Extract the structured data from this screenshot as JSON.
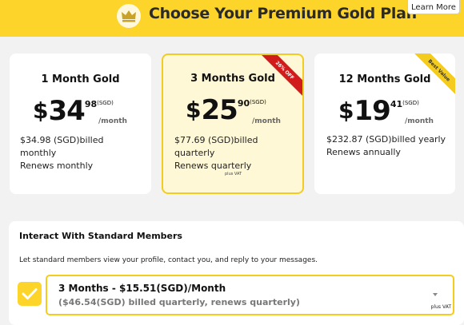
{
  "header": {
    "title": "Choose Your Premium Gold Plan",
    "learn_more_label": "Learn More",
    "icon": "crown-icon",
    "background_color": "#fdd42a"
  },
  "plans": [
    {
      "title": "1 Month Gold",
      "currency": "$",
      "price_int": "34",
      "price_dec": "98",
      "price_unit": "(SGD)",
      "per": "/month",
      "billing_text": "$34.98 (SGD)billed monthly",
      "renew_text": "Renews monthly",
      "selected": false
    },
    {
      "title": "3 Months Gold",
      "currency": "$",
      "price_int": "25",
      "price_dec": "90",
      "price_unit": "(SGD)",
      "per": "/month",
      "billing_text": "$77.69 (SGD)billed quarterly",
      "renew_text": "Renews quarterly",
      "vat_note": "plus VAT",
      "ribbon": "26% OFF",
      "ribbon_color": "#d21c1c",
      "selected": true
    },
    {
      "title": "12 Months Gold",
      "currency": "$",
      "price_int": "19",
      "price_dec": "41",
      "price_unit": "(SGD)",
      "per": "/month",
      "billing_text": "$232.87 (SGD)billed yearly",
      "renew_text": "Renews annually",
      "ribbon": "Best Value",
      "ribbon_color": "#f4cc1f",
      "selected": false
    }
  ],
  "addon": {
    "title": "Interact With Standard Members",
    "description": "Let standard members view your profile, contact you, and reply to your messages.",
    "checked": true,
    "select": {
      "main": "3 Months - $15.51(SGD)/Month",
      "sub": "($46.54(SGD) billed quarterly, renews quarterly)",
      "vat_note": "plus VAT"
    }
  },
  "colors": {
    "accent": "#fdd42a",
    "highlight_border": "#f4cc1f",
    "selected_card_bg": "#fff8d6",
    "discount_ribbon": "#d21c1c"
  }
}
